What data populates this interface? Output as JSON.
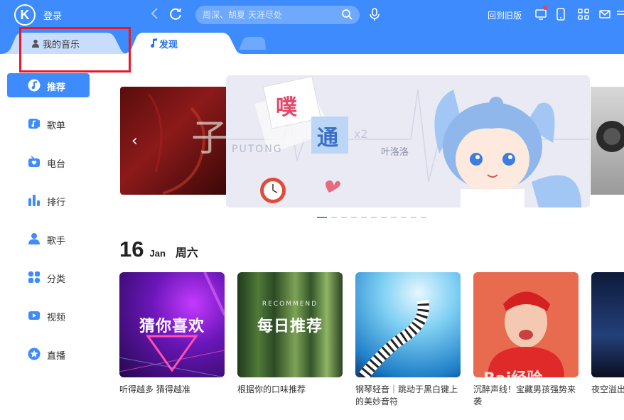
{
  "header": {
    "logo_letter": "K",
    "login_label": "登录",
    "search_placeholder": "周深、胡夏 天涯尽处",
    "back_old_label": "回到旧版"
  },
  "tabs": [
    {
      "label": "我的音乐",
      "active": false
    },
    {
      "label": "发现",
      "active": true
    }
  ],
  "sidebar": {
    "items": [
      {
        "label": "推荐",
        "icon": "music-note-icon",
        "active": true
      },
      {
        "label": "歌单",
        "icon": "playlist-icon"
      },
      {
        "label": "电台",
        "icon": "radio-icon"
      },
      {
        "label": "排行",
        "icon": "chart-icon"
      },
      {
        "label": "歌手",
        "icon": "singer-icon"
      },
      {
        "label": "分类",
        "icon": "category-icon"
      },
      {
        "label": "视频",
        "icon": "video-icon"
      },
      {
        "label": "直播",
        "icon": "live-icon"
      }
    ]
  },
  "banner": {
    "text_a": "PUTONG",
    "text_b": "通",
    "text_c": "x2",
    "text_d": "叶洛洛",
    "dot_count": 11,
    "active_dot": 0
  },
  "date": {
    "day": "16",
    "month": "Jan",
    "weekday": "周六"
  },
  "cards": [
    {
      "overlay": "猜你喜欢",
      "caption": "听得越多 猜得越准"
    },
    {
      "overlay": "每日推荐",
      "sub": "RECOMMEND",
      "caption": "根据你的口味推荐"
    },
    {
      "overlay": "",
      "caption": "钢琴轻音｜跳动于黑白键上的美妙音符"
    },
    {
      "overlay": "",
      "caption": "沉醉声线！宝藏男孩强势来袭"
    },
    {
      "overlay": "",
      "caption": "夜空溢出 我点缀"
    }
  ],
  "watermark": "Bai经验"
}
